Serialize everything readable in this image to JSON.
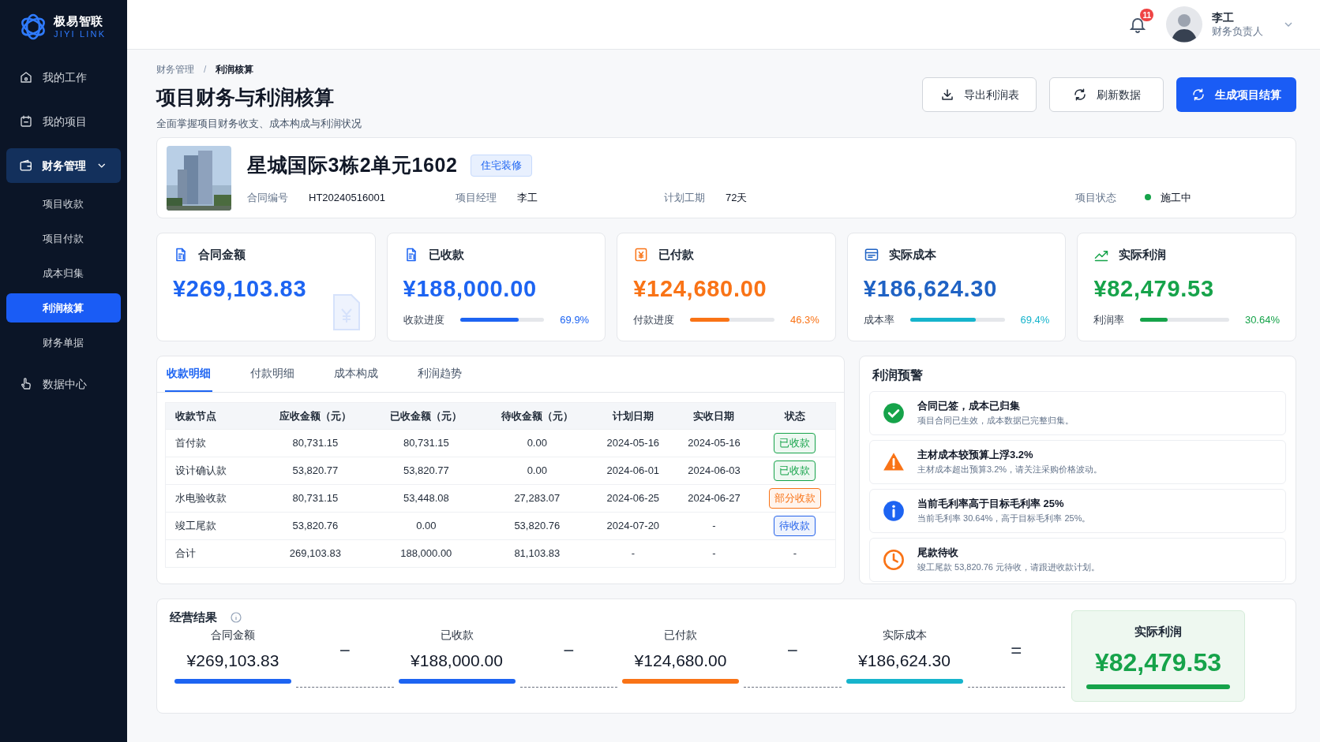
{
  "brand": {
    "name": "极易智联",
    "sub": "JIYI LINK"
  },
  "nav": [
    {
      "label": "我的工作",
      "selected": false
    },
    {
      "label": "我的项目",
      "selected": false
    },
    {
      "label": "财务管理",
      "selected": true,
      "expanded": true,
      "children": [
        {
          "label": "项目收款",
          "selected": false
        },
        {
          "label": "项目付款",
          "selected": false
        },
        {
          "label": "成本归集",
          "selected": false
        },
        {
          "label": "利润核算",
          "selected": true
        },
        {
          "label": "财务单据",
          "selected": false
        }
      ]
    },
    {
      "label": "数据中心",
      "selected": false
    }
  ],
  "header": {
    "notifications": "11",
    "user": "李工",
    "role": "财务负责人"
  },
  "breadcrumb": [
    "财务管理",
    "利润核算"
  ],
  "breadcrumb_separator": "/",
  "title": "项目财务与利润核算",
  "subtitle": "全面掌握项目财务收支、成本构成与利润状况",
  "actions": [
    {
      "label": "导出利润表",
      "kind": "outline"
    },
    {
      "label": "刷新数据",
      "kind": "outline"
    },
    {
      "label": "生成项目结算",
      "kind": "primary"
    }
  ],
  "project": {
    "name": "星城国际3栋2单元1602",
    "tag": "住宅装修",
    "fields": [
      {
        "label": "合同编号",
        "value": "HT20240516001"
      },
      {
        "label": "项目经理",
        "value": "李工"
      },
      {
        "label": "计划工期",
        "value": "72天"
      }
    ],
    "status": {
      "label": "项目状态",
      "value": "施工中",
      "color": "#16a34a"
    }
  },
  "stats": [
    {
      "label": "合同金额",
      "amount": "¥269,103.83",
      "color": "#1d64f2"
    },
    {
      "label": "已收款",
      "amount": "¥188,000.00",
      "color": "#1d64f2",
      "progress": {
        "label": "收款进度",
        "level": 0.699,
        "reading": "69.9%",
        "color": "#1d64f2"
      }
    },
    {
      "label": "已付款",
      "amount": "¥124,680.00",
      "color": "#f97316",
      "progress": {
        "label": "付款进度",
        "level": 0.463,
        "reading": "46.3%",
        "color": "#f97316"
      }
    },
    {
      "label": "实际成本",
      "amount": "¥186,624.30",
      "color": "#1f62c4",
      "progress": {
        "label": "成本率",
        "level": 0.694,
        "reading": "69.4%",
        "color": "#16b4cc"
      }
    },
    {
      "label": "实际利润",
      "amount": "¥82,479.53",
      "color": "#16a34a",
      "progress": {
        "label": "利润率",
        "level": 0.3064,
        "reading": "30.64%",
        "color": "#16a34a"
      }
    }
  ],
  "tabs": [
    {
      "label": "收款明细",
      "selected": true
    },
    {
      "label": "付款明细",
      "selected": false
    },
    {
      "label": "成本构成",
      "selected": false
    },
    {
      "label": "利润趋势",
      "selected": false
    }
  ],
  "table": {
    "columns": [
      "收款节点",
      "应收金额（元）",
      "已收金额（元）",
      "待收金额（元）",
      "计划日期",
      "实收日期",
      "状态"
    ],
    "rows": [
      {
        "cells": [
          "首付款",
          "80,731.15",
          "80,731.15",
          "0.00",
          "2024-05-16",
          "2024-05-16"
        ],
        "status": {
          "label": "已收款",
          "color": "#16a34a"
        }
      },
      {
        "cells": [
          "设计确认款",
          "53,820.77",
          "53,820.77",
          "0.00",
          "2024-06-01",
          "2024-06-03"
        ],
        "status": {
          "label": "已收款",
          "color": "#16a34a"
        }
      },
      {
        "cells": [
          "水电验收款",
          "80,731.15",
          "53,448.08",
          "27,283.07",
          "2024-06-25",
          "2024-06-27"
        ],
        "status": {
          "label": "部分收款",
          "color": "#f97316"
        }
      },
      {
        "cells": [
          "竣工尾款",
          "53,820.76",
          "0.00",
          "53,820.76",
          "2024-07-20",
          "-"
        ],
        "status": {
          "label": "待收款",
          "color": "#2563eb"
        }
      },
      {
        "cells": [
          "合计",
          "269,103.83",
          "188,000.00",
          "81,103.83",
          "-",
          "-",
          "-"
        ]
      }
    ]
  },
  "alerts_title": "利润预警",
  "alerts": [
    {
      "kind": "success",
      "title": "合同已签，成本已归集",
      "text": "项目合同已生效，成本数据已完整归集。"
    },
    {
      "kind": "warning",
      "title": "主材成本较预算上浮3.2%",
      "text": "主材成本超出预算3.2%，请关注采购价格波动。"
    },
    {
      "kind": "info",
      "title": "当前毛利率高于目标毛利率 25%",
      "text": "当前毛利率 30.64%，高于目标毛利率 25%。"
    },
    {
      "kind": "pending",
      "title": "尾款待收",
      "text": "竣工尾款 53,820.76 元待收，请跟进收款计划。"
    }
  ],
  "result": {
    "title": "经营结果",
    "terms": [
      {
        "label": "合同金额",
        "amount": "¥269,103.83",
        "color": "#1d64f2",
        "operator": "−"
      },
      {
        "label": "已收款",
        "amount": "¥188,000.00",
        "color": "#1d64f2",
        "operator": "−"
      },
      {
        "label": "已付款",
        "amount": "¥124,680.00",
        "color": "#f97316",
        "operator": "−"
      },
      {
        "label": "实际成本",
        "amount": "¥186,624.30",
        "color": "#16b4cc",
        "operator": "="
      }
    ],
    "total": {
      "label": "实际利润",
      "amount": "¥82,479.53",
      "color": "#16a34a"
    }
  }
}
